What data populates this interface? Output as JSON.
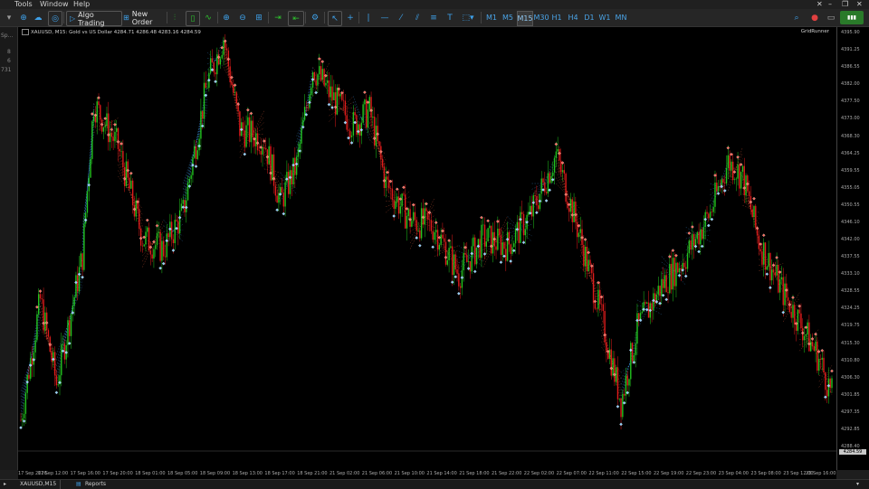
{
  "menu": {
    "items": [
      "Tools",
      "Window",
      "Help"
    ]
  },
  "toolbar": {
    "algo_trading": "Algo Trading",
    "new_order": "New Order",
    "timeframes": [
      "M1",
      "M5",
      "M15",
      "M30",
      "H1",
      "H4",
      "D1",
      "W1",
      "MN"
    ],
    "selected_timeframe": "M15"
  },
  "left_panel": {
    "labels": [
      "Sp...",
      "8",
      "6",
      "731"
    ]
  },
  "chart": {
    "header": "XAUUSD, M15:  Gold vs US Dollar  4284.71 4286.48 4283.16 4284.59",
    "ea_name": "GridRunner"
  },
  "price_axis": {
    "labels": [
      "4395.90",
      "4391.25",
      "4386.55",
      "4382.00",
      "4377.50",
      "4373.00",
      "4368.30",
      "4364.25",
      "4359.55",
      "4355.05",
      "4350.55",
      "4346.10",
      "4342.00",
      "4337.55",
      "4333.10",
      "4328.55",
      "4324.25",
      "4319.75",
      "4315.30",
      "4310.80",
      "4306.30",
      "4301.85",
      "4297.35",
      "4292.85",
      "4288.40"
    ],
    "current_price": "4284.59"
  },
  "time_axis": {
    "labels": [
      "17 Sep 2026",
      "17 Sep 12:00",
      "17 Sep 16:00",
      "17 Sep 20:00",
      "18 Sep 01:00",
      "18 Sep 05:00",
      "18 Sep 09:00",
      "18 Sep 13:00",
      "18 Sep 17:00",
      "18 Sep 21:00",
      "21 Sep 02:00",
      "21 Sep 06:00",
      "21 Sep 10:00",
      "21 Sep 14:00",
      "21 Sep 18:00",
      "21 Sep 22:00",
      "22 Sep 02:00",
      "22 Sep 07:00",
      "22 Sep 11:00",
      "22 Sep 15:00",
      "22 Sep 19:00",
      "22 Sep 23:00",
      "23 Sep 04:00",
      "23 Sep 08:00",
      "23 Sep 12:00",
      "23 Sep 16:00"
    ]
  },
  "tabs": {
    "chart_tab": "XAUUSD,M15",
    "reports": "Reports"
  },
  "chart_data": {
    "type": "candlestick",
    "symbol": "XAUUSD",
    "timeframe": "M15",
    "ylim": [
      4285,
      4398
    ],
    "anchors": [
      [
        0,
        4295
      ],
      [
        12,
        4328
      ],
      [
        22,
        4305
      ],
      [
        38,
        4340
      ],
      [
        45,
        4382
      ],
      [
        60,
        4370
      ],
      [
        75,
        4345
      ],
      [
        88,
        4342
      ],
      [
        100,
        4352
      ],
      [
        115,
        4388
      ],
      [
        125,
        4400
      ],
      [
        135,
        4375
      ],
      [
        150,
        4372
      ],
      [
        160,
        4355
      ],
      [
        170,
        4365
      ],
      [
        180,
        4392
      ],
      [
        190,
        4385
      ],
      [
        205,
        4376
      ],
      [
        215,
        4380
      ],
      [
        225,
        4360
      ],
      [
        240,
        4350
      ],
      [
        255,
        4348
      ],
      [
        270,
        4335
      ],
      [
        285,
        4345
      ],
      [
        300,
        4343
      ],
      [
        315,
        4352
      ],
      [
        330,
        4368
      ],
      [
        345,
        4345
      ],
      [
        358,
        4323
      ],
      [
        370,
        4300
      ],
      [
        380,
        4320
      ],
      [
        395,
        4332
      ],
      [
        410,
        4340
      ],
      [
        425,
        4352
      ],
      [
        436,
        4366
      ],
      [
        445,
        4362
      ],
      [
        455,
        4344
      ],
      [
        470,
        4330
      ],
      [
        480,
        4322
      ],
      [
        492,
        4312
      ],
      [
        500,
        4302
      ]
    ],
    "colors": {
      "up": "#22c41e",
      "down": "#e01b1b",
      "grid_buy": "#3a8fd8",
      "grid_sell": "#d85a3a",
      "background": "#000000"
    }
  }
}
